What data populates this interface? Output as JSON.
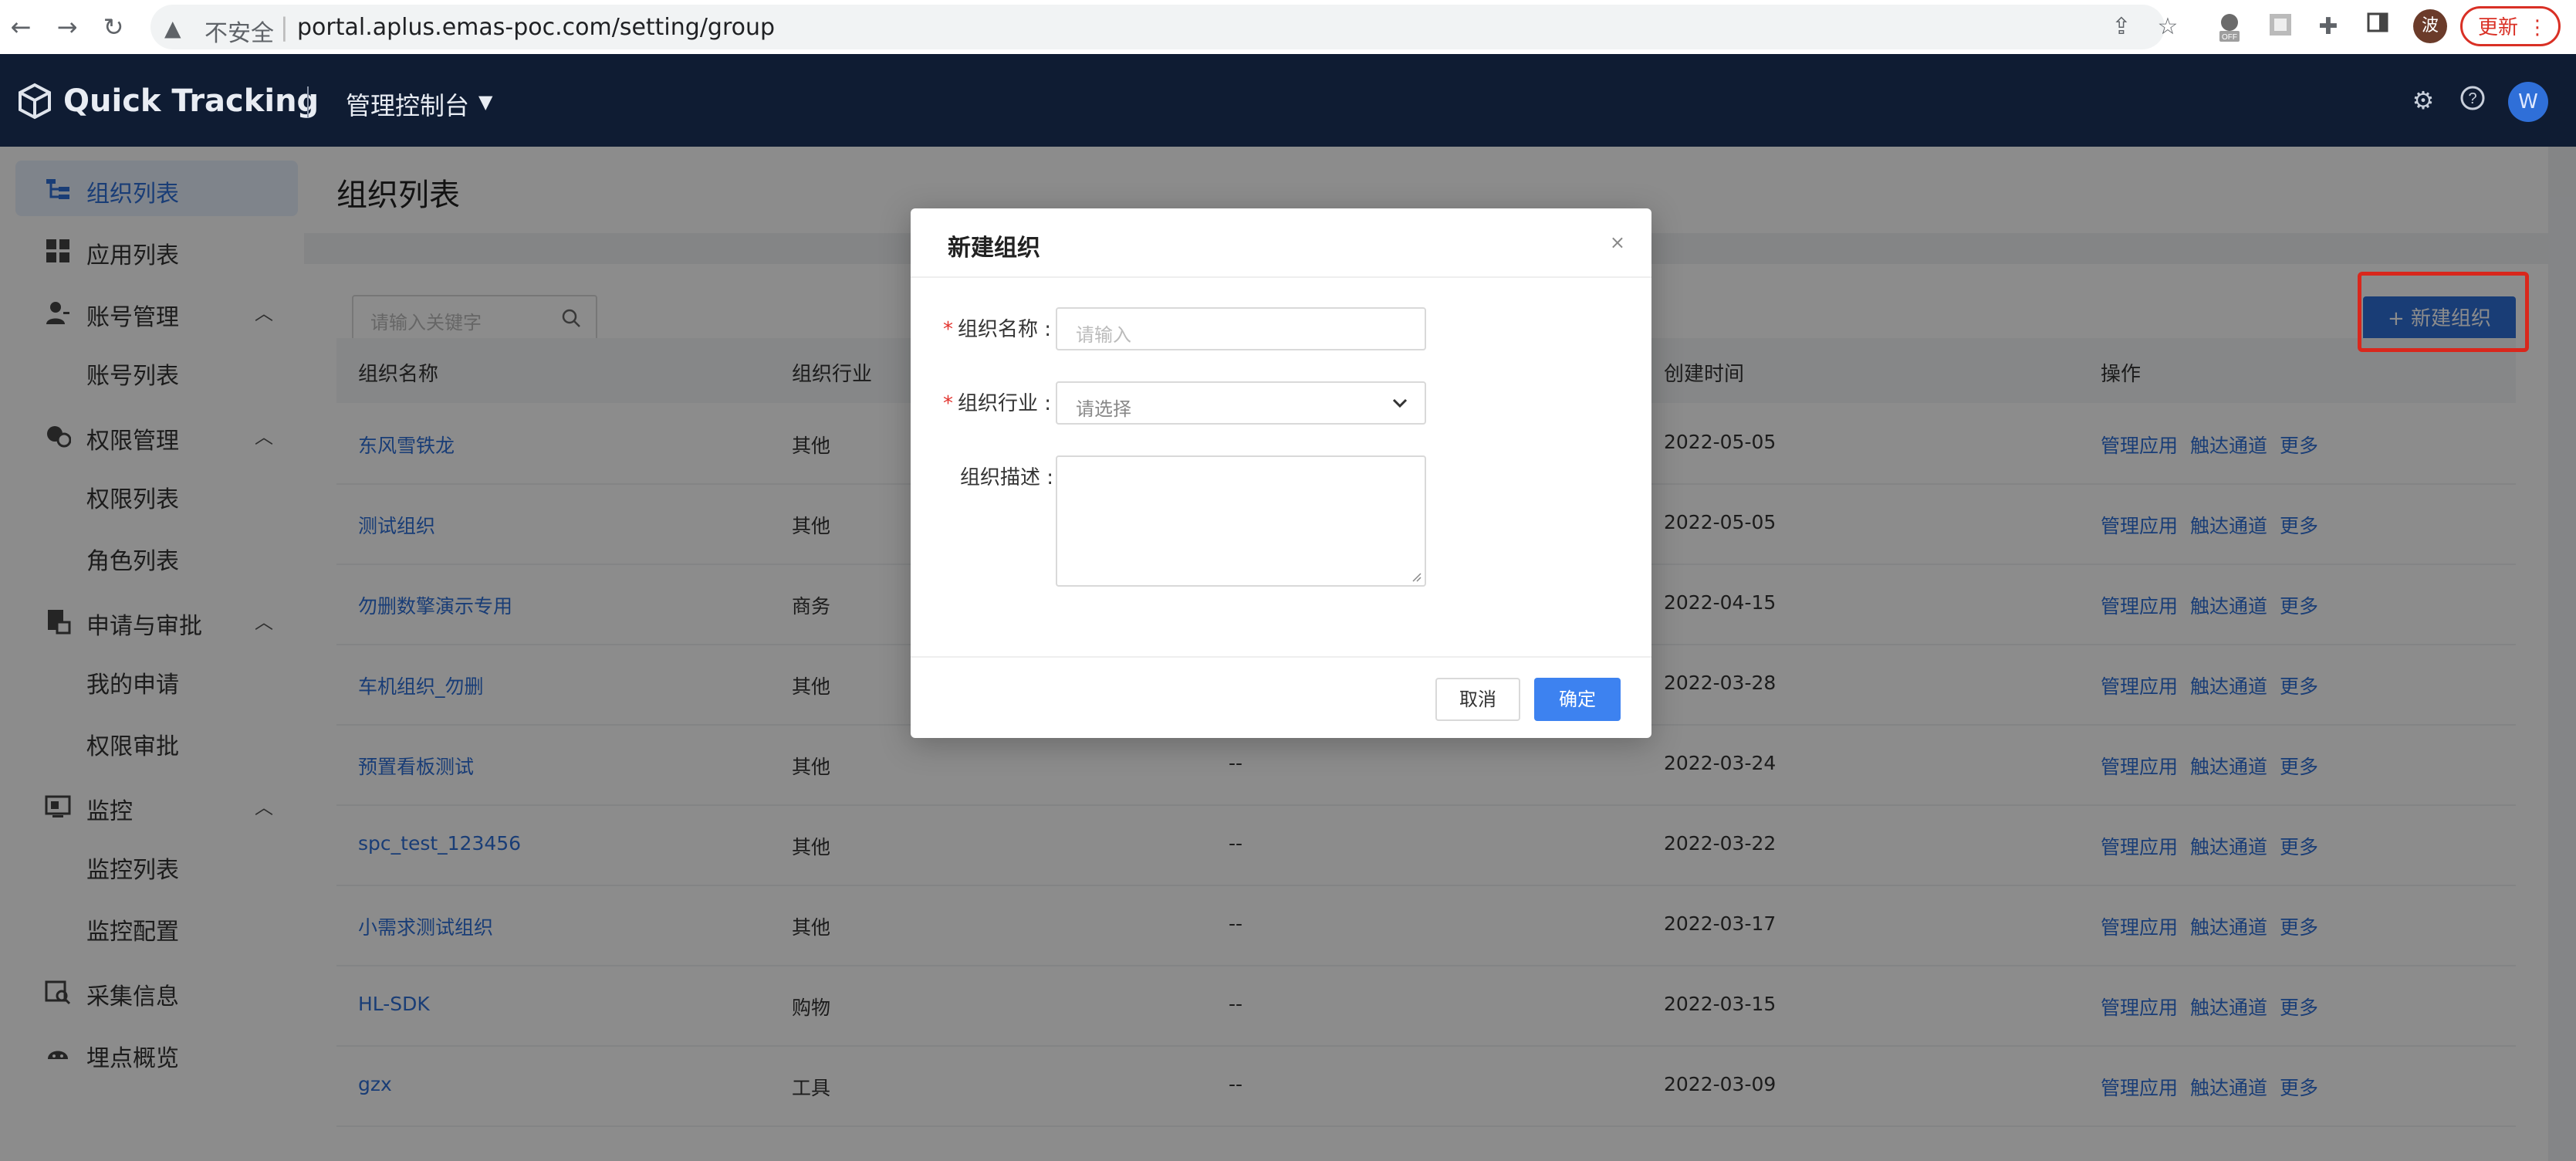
{
  "browser": {
    "url_insecure_label": "不安全",
    "url": "portal.aplus.emas-poc.com/setting/group",
    "profile_initial": "波",
    "update_label": "更新",
    "ext_off_label": "OFF"
  },
  "header": {
    "logo_text": "Quick Tracking",
    "console_label": "管理控制台",
    "user_initial": "W"
  },
  "sidebar": {
    "items": [
      {
        "label": "组织列表",
        "icon": "org-list-icon",
        "active": true
      },
      {
        "label": "应用列表",
        "icon": "app-grid-icon"
      },
      {
        "label": "账号管理",
        "icon": "user-icon",
        "expanded": true
      },
      {
        "label": "账号列表"
      },
      {
        "label": "权限管理",
        "icon": "permission-icon",
        "expanded": true
      },
      {
        "label": "权限列表"
      },
      {
        "label": "角色列表"
      },
      {
        "label": "申请与审批",
        "icon": "approval-icon",
        "expanded": true
      },
      {
        "label": "我的申请"
      },
      {
        "label": "权限审批"
      },
      {
        "label": "监控",
        "icon": "monitor-icon",
        "expanded": true
      },
      {
        "label": "监控列表"
      },
      {
        "label": "监控配置"
      },
      {
        "label": "采集信息",
        "icon": "collect-icon"
      },
      {
        "label": "埋点概览",
        "icon": "tracking-icon"
      }
    ]
  },
  "main": {
    "page_title": "组织列表",
    "search_placeholder": "请输入关键字",
    "new_org_button": "+ 新建组织",
    "columns": [
      "组织名称",
      "组织行业",
      "创建时间",
      "操作"
    ],
    "rows": [
      {
        "name": "东风雪铁龙",
        "industry": "其他",
        "desc": "",
        "created": "2022-05-05"
      },
      {
        "name": "测试组织",
        "industry": "其他",
        "desc": "",
        "created": "2022-05-05"
      },
      {
        "name": "勿删数擎演示专用",
        "industry": "商务",
        "desc": "",
        "created": "2022-04-15"
      },
      {
        "name": "车机组织_勿删",
        "industry": "其他",
        "desc": "",
        "created": "2022-03-28"
      },
      {
        "name": "预置看板测试",
        "industry": "其他",
        "desc": "--",
        "created": "2022-03-24"
      },
      {
        "name": "spc_test_123456",
        "industry": "其他",
        "desc": "--",
        "created": "2022-03-22"
      },
      {
        "name": "小需求测试组织",
        "industry": "其他",
        "desc": "--",
        "created": "2022-03-17"
      },
      {
        "name": "HL-SDK",
        "industry": "购物",
        "desc": "--",
        "created": "2022-03-15"
      },
      {
        "name": "gzx",
        "industry": "工具",
        "desc": "--",
        "created": "2022-03-09"
      }
    ],
    "actions": [
      "管理应用",
      "触达通道",
      "更多"
    ]
  },
  "modal": {
    "title": "新建组织",
    "close": "×",
    "name_label": "组织名称 :",
    "name_placeholder": "请输入",
    "industry_label": "组织行业 :",
    "industry_placeholder": "请选择",
    "desc_label": "组织描述 :",
    "cancel": "取消",
    "ok": "确定",
    "required_mark": "*"
  },
  "colors": {
    "header_bg": "#0f1c33",
    "primary": "#2f6fd8",
    "highlight_box": "#d9271c"
  }
}
